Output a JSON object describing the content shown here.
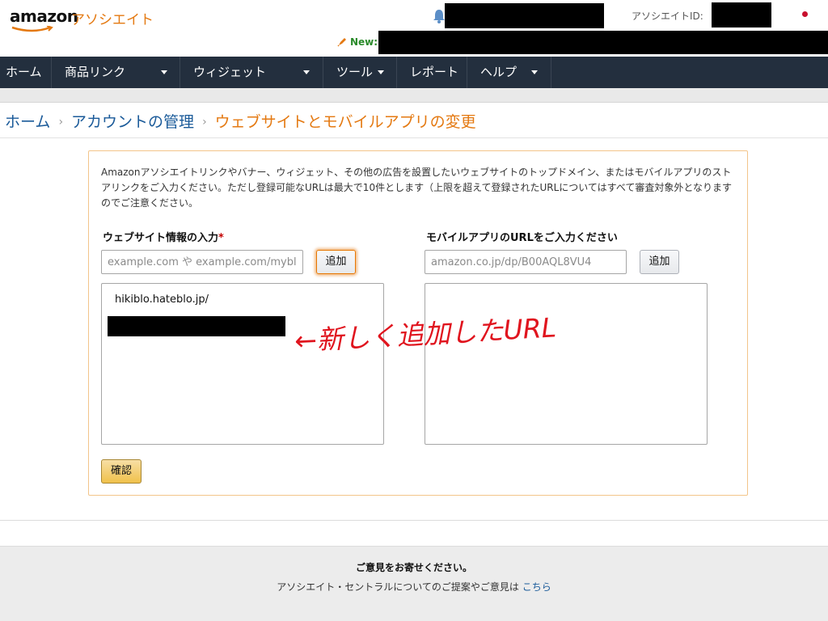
{
  "header": {
    "logo_brand": "amazon",
    "logo_suffix": "アソシエイト",
    "associate_id_label": "アソシエイトID:",
    "new_label": "New:"
  },
  "nav": {
    "items": [
      {
        "label": "ホーム",
        "has_dropdown": false
      },
      {
        "label": "商品リンク",
        "has_dropdown": true
      },
      {
        "label": "ウィジェット",
        "has_dropdown": true
      },
      {
        "label": "ツール",
        "has_dropdown": true
      },
      {
        "label": "レポート",
        "has_dropdown": false
      },
      {
        "label": "ヘルプ",
        "has_dropdown": true
      }
    ]
  },
  "breadcrumb": {
    "home": "ホーム",
    "account": "アカウントの管理",
    "current": "ウェブサイトとモバイルアプリの変更",
    "separator": "›"
  },
  "form": {
    "intro": "Amazonアソシエイトリンクやバナー、ウィジェット、その他の広告を設置したいウェブサイトのトップドメイン、またはモバイルアプリのストアリンクをご入力ください。ただし登録可能なURLは最大で10件とします（上限を超えて登録されたURLについてはすべて審査対象外となりますのでご注意ください。",
    "website": {
      "label": "ウェブサイト情報の入力",
      "required_mark": "*",
      "placeholder": "example.com や example.com/myblog",
      "value": "",
      "add_button": "追加",
      "entries": [
        "hikiblo.hateblo.jp/"
      ]
    },
    "mobile": {
      "label": "モバイルアプリのURLをご入力ください",
      "placeholder": "amazon.co.jp/dp/B00AQL8VU4",
      "value": "",
      "add_button": "追加",
      "entries": []
    },
    "confirm_button": "確認"
  },
  "annotation": {
    "text": "←新しく追加したURL",
    "color": "#e0141e"
  },
  "footer": {
    "title": "ご意見をお寄せください。",
    "text": "アソシエイト・セントラルについてのご提案やご意見は",
    "link": "こちら"
  },
  "colors": {
    "nav_bg": "#232f3e",
    "accent_orange": "#e47911",
    "link_blue": "#1a5a99",
    "confirm_yellow": "#f0c14b"
  }
}
